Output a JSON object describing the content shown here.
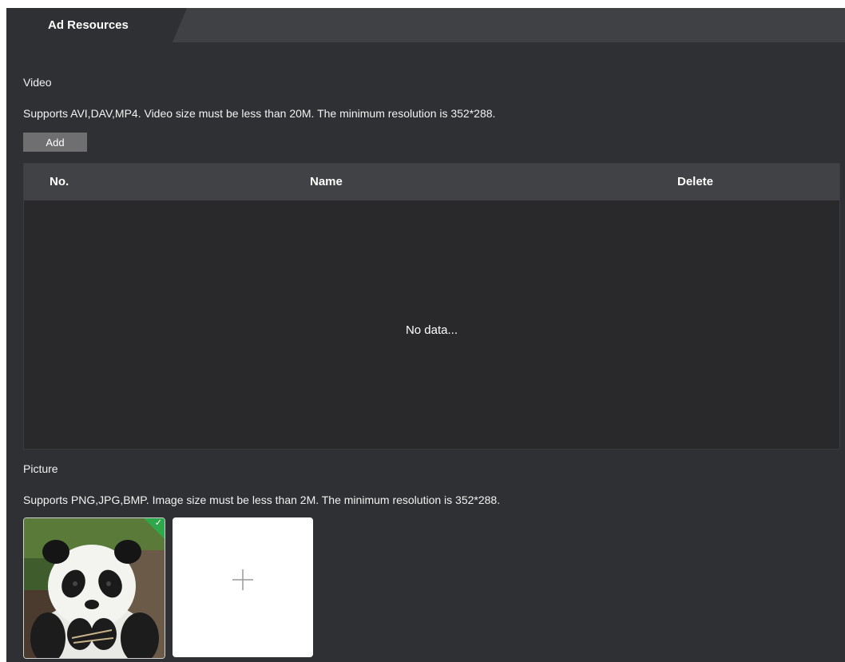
{
  "tabs": [
    {
      "label": "Ad Resources"
    }
  ],
  "video": {
    "title": "Video",
    "hint": "Supports AVI,DAV,MP4. Video size must be less than 20M. The minimum resolution is 352*288.",
    "add_label": "Add",
    "table": {
      "columns": [
        "No.",
        "Name",
        "Delete"
      ],
      "rows": [],
      "empty_text": "No data..."
    }
  },
  "picture": {
    "title": "Picture",
    "hint": "Supports PNG,JPG,BMP. Image size must be less than 2M. The minimum resolution is 352*288.",
    "items": [
      {
        "image": "panda-photo",
        "selected": true
      }
    ],
    "add_icon": "plus-icon",
    "check_icon": "✓"
  },
  "colors": {
    "background": "#2f3033",
    "tabbar": "#404145",
    "table_header": "#414246",
    "button": "#6f6f72",
    "selected_badge": "#2ea84a"
  }
}
